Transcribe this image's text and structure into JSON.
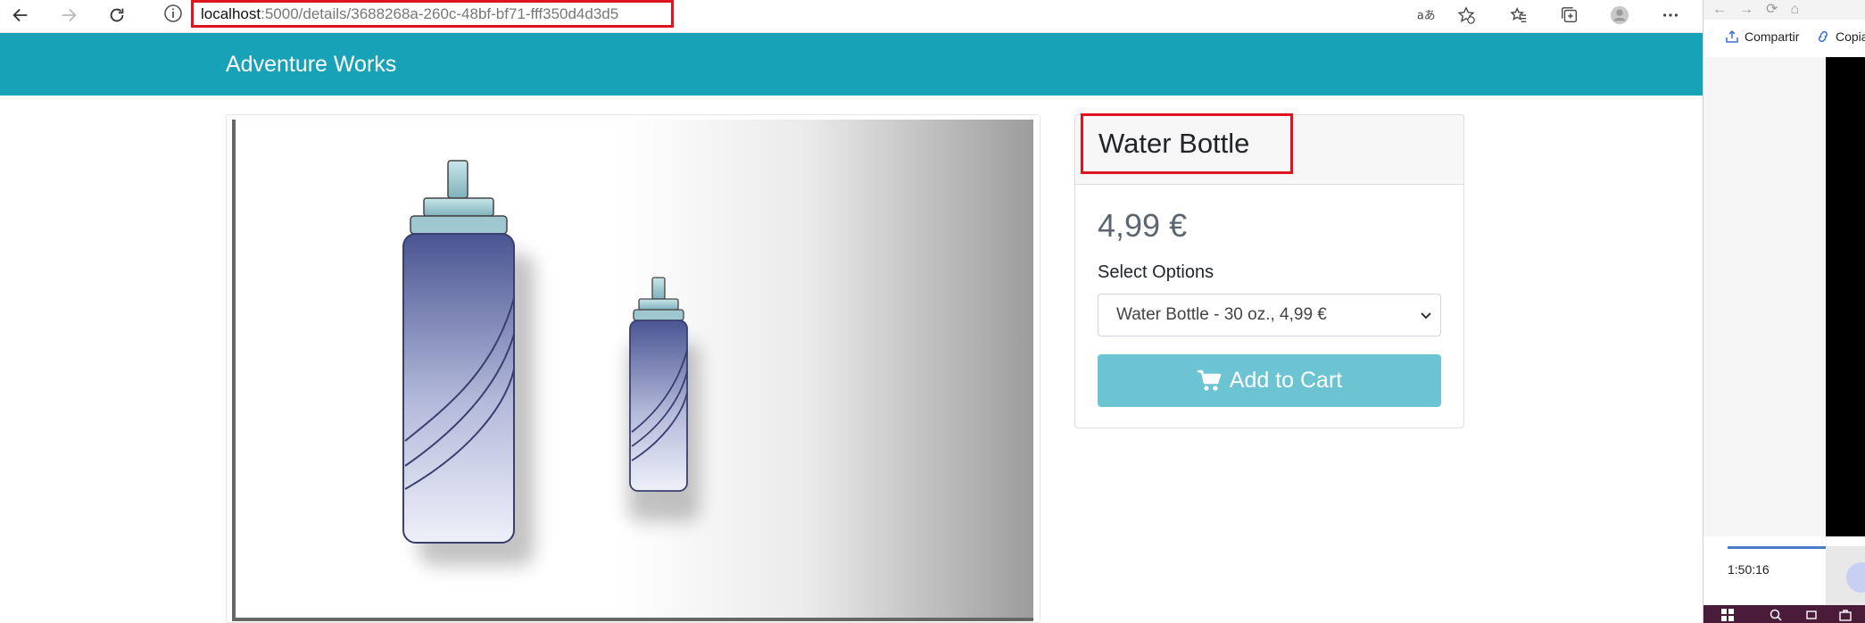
{
  "browser": {
    "url_host": "localhost",
    "url_path": ":5000/details/3688268a-260c-48bf-bf71-fff350d4d3d5"
  },
  "app": {
    "brand": "Adventure Works"
  },
  "product": {
    "title": "Water Bottle",
    "price": "4,99 €",
    "options_label": "Select Options",
    "selected_option": "Water Bottle - 30 oz., 4,99 €",
    "add_to_cart_label": "Add to Cart"
  },
  "side_window": {
    "share_label": "Compartir",
    "copy_label": "Copia",
    "timecode": "1:50:16"
  },
  "colors": {
    "navbar": "#17a2b8",
    "button": "#6cc4d3",
    "highlight": "#e0141e"
  }
}
